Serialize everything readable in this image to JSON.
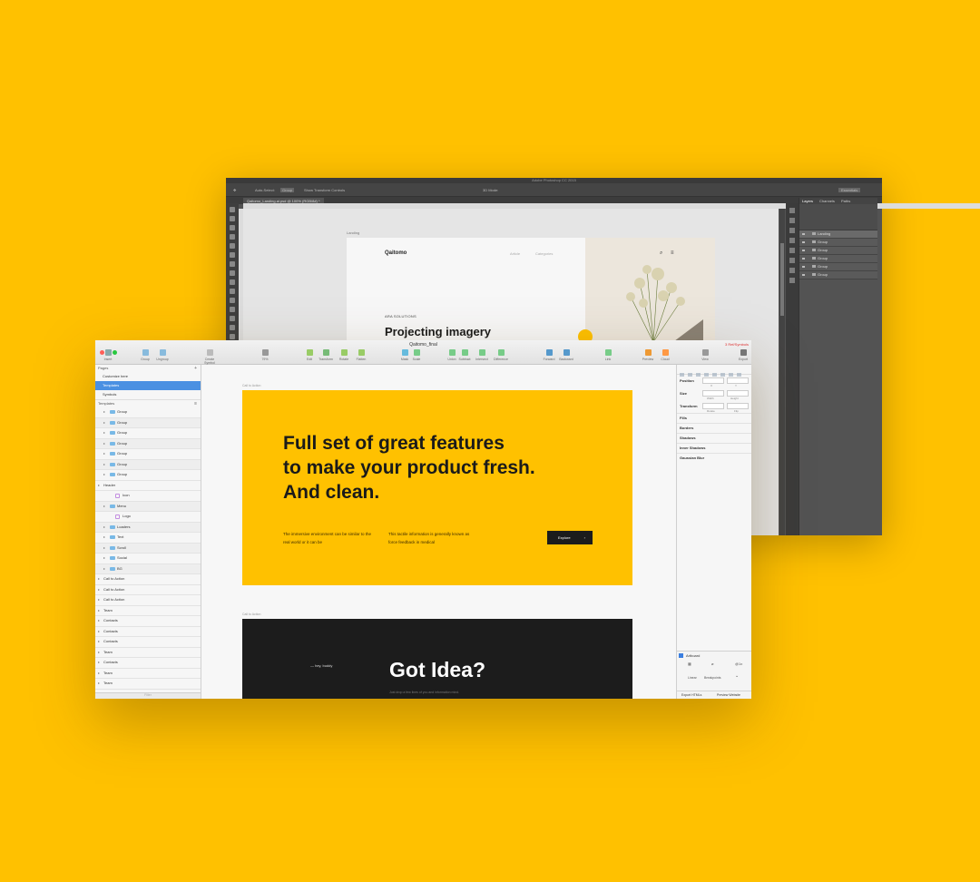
{
  "colors": {
    "accent": "#FFC100",
    "dark": "#1C1C1C",
    "sketch_select": "#4A90E2"
  },
  "photoshop": {
    "title": "Adobe Photoshop CC 2015",
    "tab": "Qaitomo_Landing.ai.psd @ 100% (RGB/8#) *",
    "options": [
      "Auto-Select:",
      "Group",
      "Show Transform Controls"
    ],
    "mode_3d": "3D Mode:",
    "workspace": "Essentials",
    "layer_tabs": [
      "Layers",
      "Channels",
      "Paths"
    ],
    "layers": [
      {
        "name": "Landing",
        "selected": true
      },
      {
        "name": "Group"
      },
      {
        "name": "Group"
      },
      {
        "name": "Group"
      },
      {
        "name": "Group"
      },
      {
        "name": "Group"
      }
    ],
    "artboard": {
      "label": "Landing",
      "logo": "Qaitomo",
      "nav": [
        "Article",
        "Categories"
      ],
      "tagline": "ARA SOLUTIONS",
      "headline": "Projecting imagery"
    }
  },
  "sketch": {
    "document_title": "Qaitomo_final",
    "warning": "3 Ref/Symbols",
    "toolbar": [
      {
        "icon": "insert-icon",
        "label": "Insert"
      },
      {
        "icon": "group-icon",
        "label": "Group"
      },
      {
        "icon": "ungroup-icon",
        "label": "Ungroup"
      },
      {
        "icon": "create-symbol-icon",
        "label": "Create Symbol"
      },
      {
        "icon": "zoom-icon",
        "label": "79%"
      },
      {
        "icon": "edit-icon",
        "label": "Edit"
      },
      {
        "icon": "transform-icon",
        "label": "Transform"
      },
      {
        "icon": "rotate-icon",
        "label": "Rotate"
      },
      {
        "icon": "flatten-icon",
        "label": "Flatten"
      },
      {
        "icon": "mask-icon",
        "label": "Mask"
      },
      {
        "icon": "scale-icon",
        "label": "Scale"
      },
      {
        "icon": "union-icon",
        "label": "Union"
      },
      {
        "icon": "subtract-icon",
        "label": "Subtract"
      },
      {
        "icon": "intersect-icon",
        "label": "Intersect"
      },
      {
        "icon": "difference-icon",
        "label": "Difference"
      },
      {
        "icon": "forward-icon",
        "label": "Forward"
      },
      {
        "icon": "backward-icon",
        "label": "Backward"
      },
      {
        "icon": "link-icon",
        "label": "Link"
      },
      {
        "icon": "preview-icon",
        "label": "Preview"
      },
      {
        "icon": "cloud-icon",
        "label": "Cloud"
      },
      {
        "icon": "view-icon",
        "label": "View"
      },
      {
        "icon": "export-icon",
        "label": "Export"
      }
    ],
    "pages_label": "Pages",
    "pages": [
      {
        "name": "Customize here",
        "selected": false
      },
      {
        "name": "Templates",
        "selected": true
      },
      {
        "name": "Symbols",
        "selected": false
      }
    ],
    "layers_label": "Templates",
    "layers": [
      {
        "name": "Group",
        "indent": 1,
        "type": "folder"
      },
      {
        "name": "Group",
        "indent": 1,
        "type": "folder"
      },
      {
        "name": "Group",
        "indent": 1,
        "type": "folder"
      },
      {
        "name": "Group",
        "indent": 1,
        "type": "folder"
      },
      {
        "name": "Group",
        "indent": 1,
        "type": "folder"
      },
      {
        "name": "Group",
        "indent": 1,
        "type": "folder"
      },
      {
        "name": "Group",
        "indent": 1,
        "type": "folder"
      },
      {
        "name": "Header",
        "indent": 0,
        "type": "artboard"
      },
      {
        "name": "Icon",
        "indent": 2,
        "type": "symbol"
      },
      {
        "name": "Menu",
        "indent": 1,
        "type": "folder"
      },
      {
        "name": "Logo",
        "indent": 2,
        "type": "symbol"
      },
      {
        "name": "Loaders",
        "indent": 1,
        "type": "folder"
      },
      {
        "name": "Text",
        "indent": 1,
        "type": "folder"
      },
      {
        "name": "Scroll",
        "indent": 1,
        "type": "folder"
      },
      {
        "name": "Social",
        "indent": 1,
        "type": "folder"
      },
      {
        "name": "BG",
        "indent": 1,
        "type": "folder"
      },
      {
        "name": "Call to Action",
        "indent": 0,
        "type": "artboard"
      },
      {
        "name": "Call to Action",
        "indent": 0,
        "type": "artboard"
      },
      {
        "name": "Call to Action",
        "indent": 0,
        "type": "artboard"
      },
      {
        "name": "Team",
        "indent": 0,
        "type": "artboard"
      },
      {
        "name": "Contacts",
        "indent": 0,
        "type": "artboard"
      },
      {
        "name": "Contacts",
        "indent": 0,
        "type": "artboard"
      },
      {
        "name": "Contacts",
        "indent": 0,
        "type": "artboard"
      },
      {
        "name": "Team",
        "indent": 0,
        "type": "artboard"
      },
      {
        "name": "Contacts",
        "indent": 0,
        "type": "artboard"
      },
      {
        "name": "Team",
        "indent": 0,
        "type": "artboard"
      },
      {
        "name": "Team",
        "indent": 0,
        "type": "artboard"
      },
      {
        "name": "Team",
        "indent": 0,
        "type": "artboard"
      },
      {
        "name": "Team",
        "indent": 0,
        "type": "artboard"
      }
    ],
    "filter_placeholder": "Filter",
    "canvas": {
      "artboard1_label": "Call to Action",
      "headline": [
        "Full set of great features",
        "to make your product fresh.",
        "And clean."
      ],
      "para1": "The immersive environment can be similar to the real world or it can be",
      "para2": "This tactile information is generally known as force feedback in medical",
      "button": "Explore",
      "button_arrow": "›",
      "artboard2_label": "Call to Action",
      "hey": "— hey, buddy",
      "dark_headline": "Got Idea?",
      "dark_sub": "Just drop a few lines of you and information mind."
    },
    "inspector": {
      "position": "Position",
      "size": "Size",
      "transform": "Transform",
      "x": "X",
      "y": "Y",
      "width": "Width",
      "height": "Height",
      "rotate": "Rotate",
      "flip": "Flip",
      "sections": [
        "Fills",
        "Borders",
        "Shadows",
        "Inner Shadows",
        "Gaussian Blur"
      ],
      "export_title": "Artboard",
      "export_size": "@1x",
      "slice": "Linear",
      "breakpoint": "Breakpoints",
      "export_btn": "Export HTMLs",
      "preview_btn": "Preview Website"
    }
  }
}
